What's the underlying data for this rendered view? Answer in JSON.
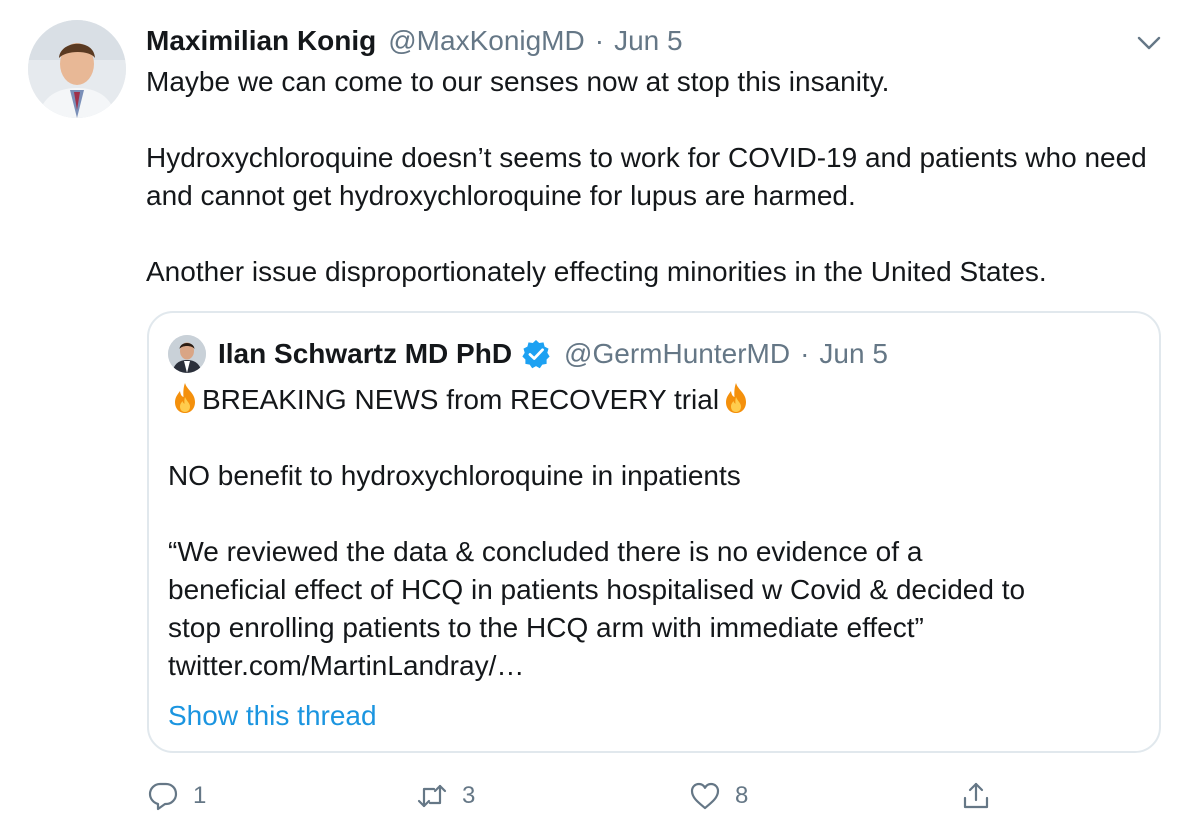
{
  "tweet": {
    "display_name": "Maximilian Konig",
    "handle": "@MaxKonigMD",
    "separator": "·",
    "date": "Jun 5",
    "text": "Maybe we can come to our senses now at stop this insanity.\n\nHydroxychloroquine doesn’t seems to work for COVID-19 and patients who need and cannot get hydroxychloroquine for lupus are harmed.\n\nAnother issue disproportionately effecting minorities in the United States."
  },
  "quoted": {
    "display_name": "Ilan Schwartz MD PhD",
    "handle": "@GermHunterMD",
    "separator": "·",
    "date": "Jun 5",
    "headline": "BREAKING NEWS from RECOVERY trial",
    "line2": "NO benefit to hydroxychloroquine in inpatients",
    "quote_line1": "“We reviewed the data & concluded there is no evidence of a",
    "quote_line2": "beneficial effect of HCQ in patients hospitalised w Covid & decided to",
    "quote_line3": "stop enrolling patients to the HCQ arm with immediate effect”",
    "link": "twitter.com/MartinLandray/…",
    "show_thread": "Show this thread"
  },
  "actions": {
    "reply_count": "1",
    "retweet_count": "3",
    "like_count": "8"
  },
  "icons": {
    "more": "chevron-down-icon",
    "verified": "verified-badge-icon",
    "fire": "fire-emoji-icon",
    "reply": "reply-icon",
    "retweet": "retweet-icon",
    "like": "heart-icon",
    "share": "share-icon"
  },
  "colors": {
    "text": "#14171a",
    "secondary": "#657786",
    "link": "#1b95e0",
    "border": "#e1e8ed",
    "verified": "#1da1f2"
  }
}
